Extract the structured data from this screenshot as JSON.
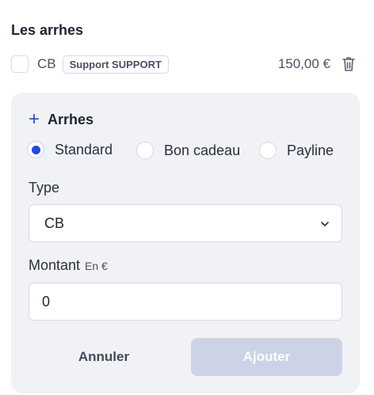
{
  "section": {
    "title": "Les arrhes"
  },
  "existing": {
    "method": "CB",
    "badge": "Support SUPPORT",
    "amount": "150,00 €",
    "delete_icon": "trash-icon"
  },
  "form": {
    "title": "Arrhes",
    "add_icon": "plus-icon",
    "radios": [
      {
        "label": "Standard",
        "checked": true
      },
      {
        "label": "Bon cadeau",
        "checked": false
      },
      {
        "label": "Payline",
        "checked": false
      }
    ],
    "type_label": "Type",
    "type_value": "CB",
    "amount_label": "Montant",
    "amount_hint": "En €",
    "amount_value": "0",
    "cancel_label": "Annuler",
    "submit_label": "Ajouter"
  },
  "colors": {
    "accent": "#2346e6",
    "panel_bg": "#f1f2f6",
    "disabled_button": "#cdd3e6"
  }
}
